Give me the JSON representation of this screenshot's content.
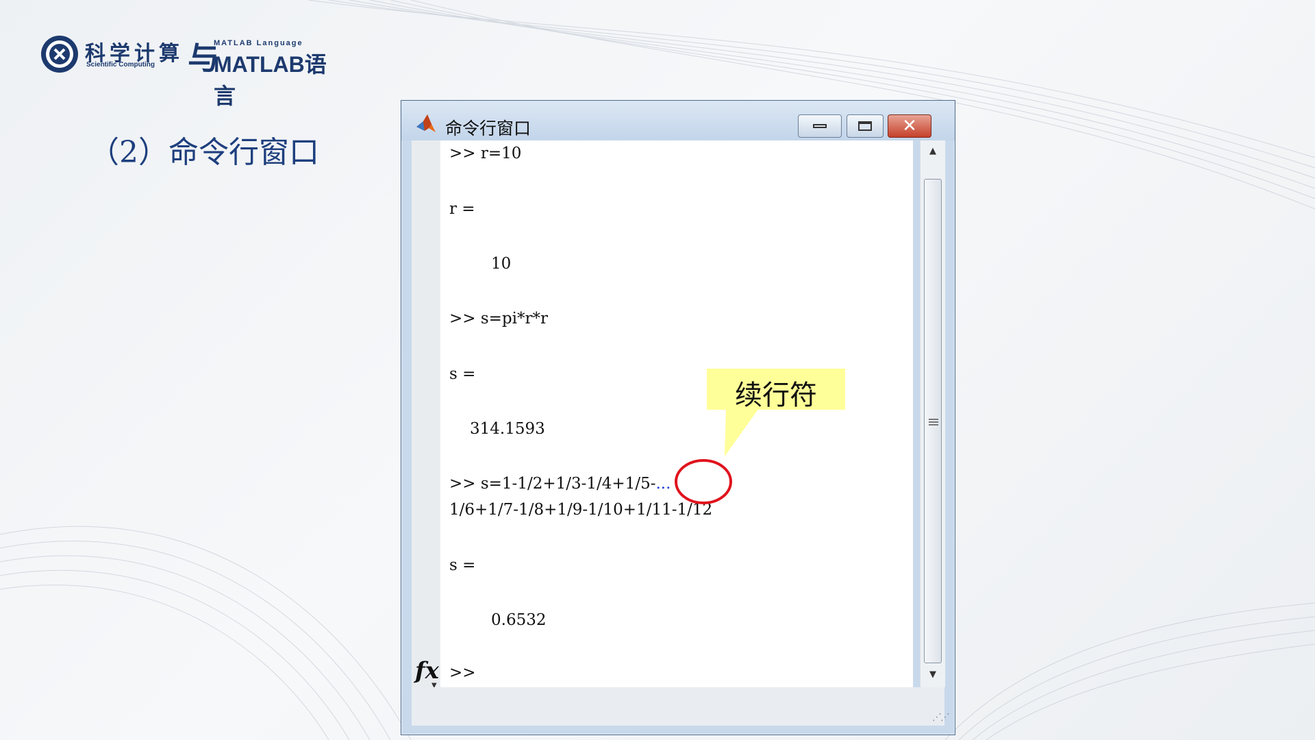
{
  "logo": {
    "cn_title": "科学计算",
    "en_subtitle": "Scientific Computing",
    "conj": "与",
    "matlab_language": "MATLAB Language",
    "matlab_lang_cn": "MATLAB语言"
  },
  "slide": {
    "heading": "（2）命令行窗口"
  },
  "window": {
    "title": "命令行窗口",
    "lines": [
      ">> r=10",
      "r =",
      "10",
      ">> s=pi*r*r",
      "s =",
      "314.1593",
      ">> s=1-1/2+1/3-1/4+1/5-",
      "...",
      "1/6+1/7-1/8+1/9-1/10+1/11-1/12",
      "s =",
      "0.6532"
    ],
    "prompt": ">>",
    "fx_label": "fx"
  },
  "callout": {
    "text": "续行符"
  },
  "colors": {
    "title_blue": "#1e3f7e",
    "callout_yellow": "#ffff99",
    "highlight_red": "#e0141e",
    "continuation_blue": "#1f3fd8"
  }
}
